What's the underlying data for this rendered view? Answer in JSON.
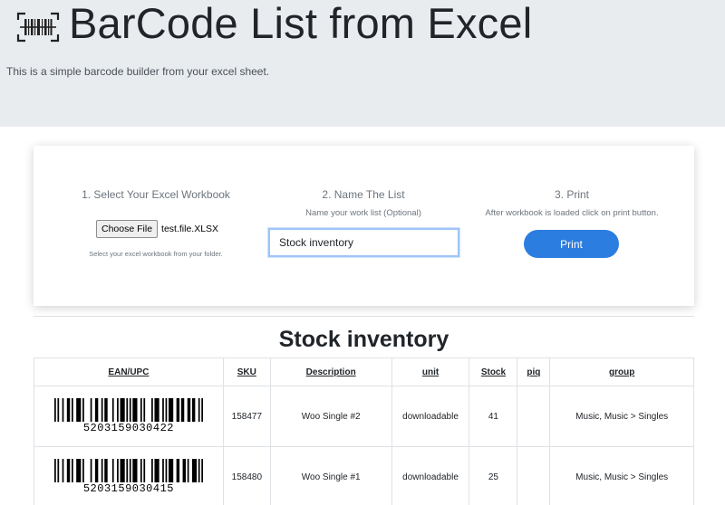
{
  "header": {
    "icon": "barcode-scan-icon",
    "title": "BarCode List from Excel",
    "lead": "This is a simple barcode builder from your excel sheet."
  },
  "steps": {
    "workbook": {
      "title": "1. Select Your Excel Workbook",
      "button_label": "Choose File",
      "file_name": "test.file.XLSX",
      "help": "Select your excel workbook from your folder."
    },
    "name": {
      "title": "2. Name The List",
      "subtitle": "Name your work list (Optional)",
      "value": "Stock inventory",
      "placeholder": ""
    },
    "print": {
      "title": "3. Print",
      "subtitle": "After workbook is loaded click on print button.",
      "button_label": "Print"
    }
  },
  "list": {
    "title": "Stock inventory",
    "columns": [
      "EAN/UPC",
      "SKU",
      "Description",
      "unit",
      "Stock",
      "piq",
      "group"
    ],
    "rows": [
      {
        "ean": "5203159030422",
        "sku": "158477",
        "description": "Woo Single #2",
        "unit": "downloadable",
        "stock": "41",
        "piq": "",
        "group": "Music, Music > Singles"
      },
      {
        "ean": "5203159030415",
        "sku": "158480",
        "description": "Woo Single #1",
        "unit": "downloadable",
        "stock": "25",
        "piq": "",
        "group": "Music, Music > Singles"
      }
    ]
  },
  "colors": {
    "hero_bg": "#e9ecef",
    "primary": "#2b7de0",
    "input_focus": "#9ec5f5"
  }
}
